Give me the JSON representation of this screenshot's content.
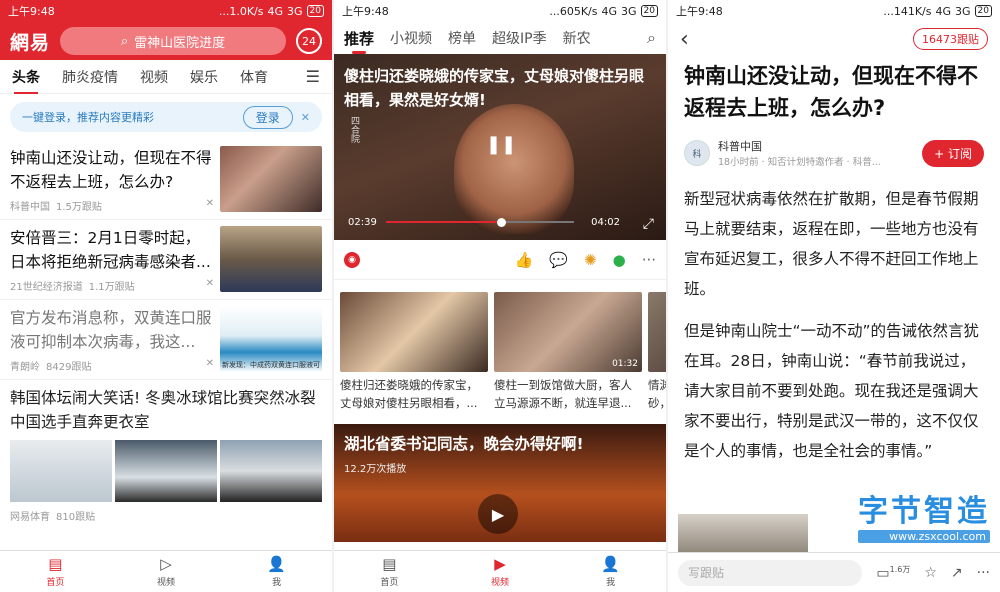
{
  "status_bars": [
    {
      "time": "上午9:48",
      "net": "...1.0K/s",
      "signal": "4G",
      "signal2": "3G",
      "battery": "20"
    },
    {
      "time": "上午9:48",
      "net": "...605K/s",
      "signal": "4G",
      "signal2": "3G",
      "battery": "20"
    },
    {
      "time": "上午9:48",
      "net": "...141K/s",
      "signal": "4G",
      "signal2": "3G",
      "battery": "20"
    }
  ],
  "news_home": {
    "logo": "網易",
    "search_text": "雷神山医院进度",
    "badge": "24",
    "tabs": [
      "头条",
      "肺炎疫情",
      "视频",
      "娱乐",
      "体育"
    ],
    "login_text": "一键登录，推荐内容更精彩",
    "login_button": "登录",
    "articles": [
      {
        "title": "钟南山还没让动，但现在不得不返程去上班，怎么办?",
        "source": "科普中国",
        "comments": "1.5万跟贴"
      },
      {
        "title": "安倍晋三：2月1日零时起，日本将拒绝新冠病毒感染者...",
        "source": "21世纪经济报道",
        "comments": "1.1万跟贴"
      },
      {
        "title": "官方发布消息称，双黄连口服液可抑制本次病毒，我这...",
        "source": "青朗岭",
        "comments": "8429跟贴"
      },
      {
        "title": "韩国体坛闹大笑话! 冬奥冰球馆比赛突然冰裂 中国选手直奔更衣室",
        "source": "网易体育",
        "comments": "810跟贴"
      }
    ],
    "thumb_caption": "新发现：中成药双黄连口服液可",
    "nav": [
      "首页",
      "视频",
      "我"
    ]
  },
  "video_page": {
    "tabs": [
      "推荐",
      "小视频",
      "榜单",
      "超级IP季",
      "新农"
    ],
    "video_title": "傻柱归还娄晓娥的传家宝，丈母娘对傻柱另眼相看，果然是好女婿!",
    "watermark": "四合院",
    "time_current": "02:39",
    "time_total": "04:02",
    "progress": 0.61,
    "related": [
      {
        "title": "傻柱归还娄晓娥的传家宝，丈母娘对傻柱另眼相看，...",
        "duration": ""
      },
      {
        "title": "傻柱一到饭馆做大厨，客人立马源源不断，就连早退...",
        "duration": "01:32"
      },
      {
        "title": "情渊砂，",
        "duration": ""
      }
    ],
    "video2_title": "湖北省委书记同志，晚会办得好啊!",
    "video2_plays": "12.2万次播放",
    "nav": [
      "首页",
      "视频",
      "我"
    ]
  },
  "article": {
    "follow_count": "16473跟贴",
    "title": "钟南山还没让动，但现在不得不返程去上班，怎么办?",
    "author": "科普中国",
    "author_meta": "18小时前 · 知否计划特邀作者 · 科普...",
    "subscribe": "+ 订阅",
    "paragraphs": [
      "新型冠状病毒依然在扩散期，但是春节假期马上就要结束，返程在即，一些地方也没有宣布延迟复工，很多人不得不赶回工作地上班。",
      "但是钟南山院士“一动不动”的告诫依然言犹在耳。28日，钟南山说：“春节前我说过，请大家目前不要到处跑。现在我还是强调大家不要出行，特别是武汉一带的，这不仅仅是个人的事情，也是全社会的事情。”"
    ],
    "comment_placeholder": "写跟贴",
    "comment_count": "1.6万",
    "watermark_big": "字节智造",
    "watermark_small": "www.zsxcool.com"
  }
}
